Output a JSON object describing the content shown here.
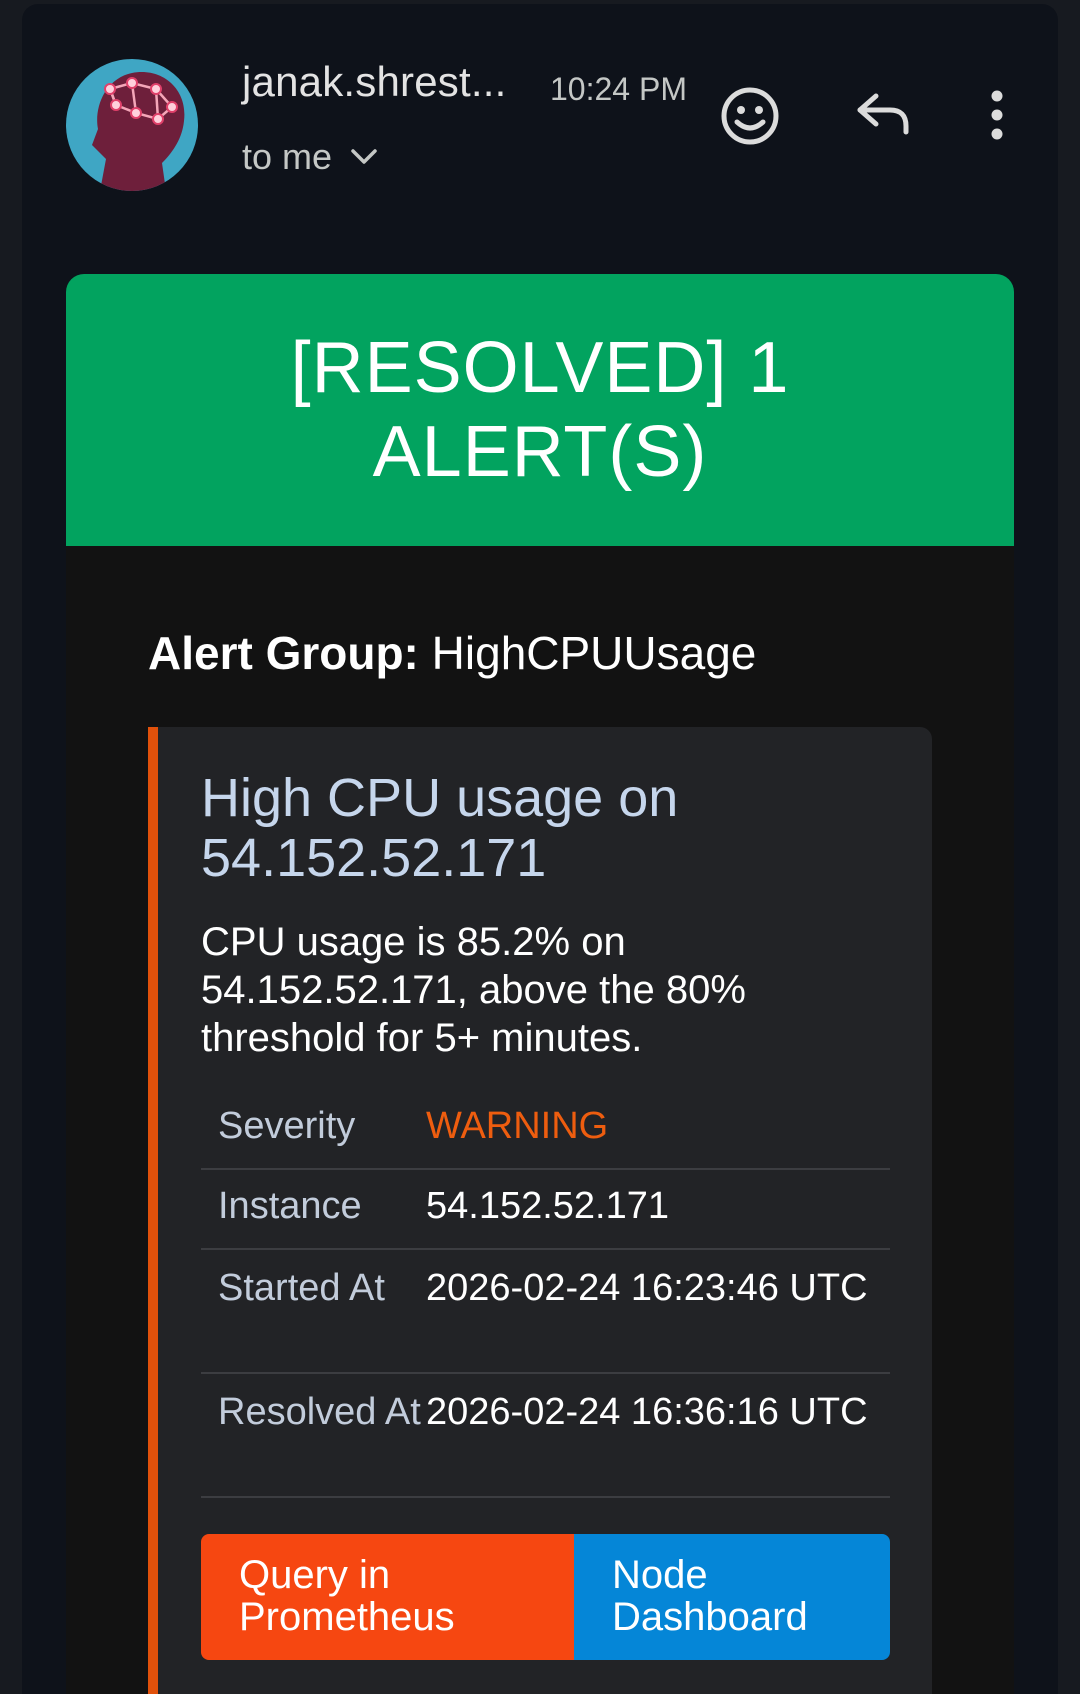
{
  "header": {
    "sender": "janak.shrest...",
    "time": "10:24 PM",
    "recipient": "to me",
    "icons": [
      "avatar",
      "chevron-down-icon",
      "emoji-icon",
      "reply-icon",
      "more-vert-icon"
    ]
  },
  "banner": {
    "title": "[RESOLVED] 1 ALERT(S)",
    "color": "#02a35f"
  },
  "alert_group": {
    "label": "Alert Group:",
    "value": "HighCPUUsage"
  },
  "alert": {
    "title": "High CPU usage on 54.152.52.171",
    "description": "CPU usage is 85.2% on 54.152.52.171, above the 80% threshold for 5+ minutes.",
    "accent_color": "#e1510b",
    "details": [
      {
        "key": "Severity",
        "value": "WARNING"
      },
      {
        "key": "Instance",
        "value": "54.152.52.171"
      },
      {
        "key": "Started At",
        "value": "2026-02-24 16:23:46 UTC"
      },
      {
        "key": "Resolved At",
        "value": "2026-02-24 16:36:16 UTC"
      }
    ],
    "severity_color": "#ee5d0f"
  },
  "actions": {
    "prometheus": "Query in Prometheus",
    "dashboard": "Node Dashboard",
    "prometheus_color": "#f64711",
    "dashboard_color": "#0586d7"
  }
}
